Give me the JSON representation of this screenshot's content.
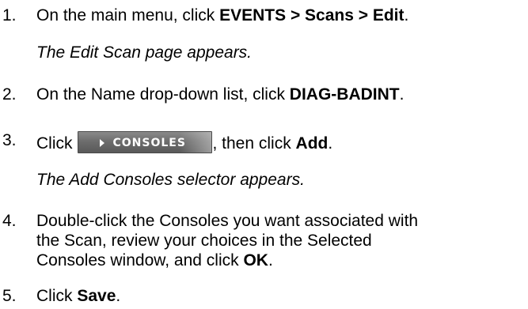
{
  "steps": [
    {
      "number": "1.",
      "text_before": "On the main menu, click ",
      "bold": "EVENTS > Scans > Edit",
      "text_after": ".",
      "result": "The Edit Scan page appears."
    },
    {
      "number": "2.",
      "text_before": "On the Name drop-down list, click ",
      "bold": "DIAG-BADINT",
      "text_after": "."
    },
    {
      "number": "3.",
      "text_before": "Click",
      "button_label": "CONSOLES",
      "button_icon": "play-arrow-icon",
      "text_middle": ", then click ",
      "bold": "Add",
      "text_after": ".",
      "result": "The Add Consoles selector appears."
    },
    {
      "number": "4.",
      "lines": [
        "Double-click the Consoles you want associated with",
        "the Scan, review your choices in the Selected"
      ],
      "line3_before": "Consoles window, and click ",
      "bold": "OK",
      "text_after": "."
    },
    {
      "number": "5.",
      "text_before": "Click ",
      "bold": "Save",
      "text_after": "."
    }
  ]
}
